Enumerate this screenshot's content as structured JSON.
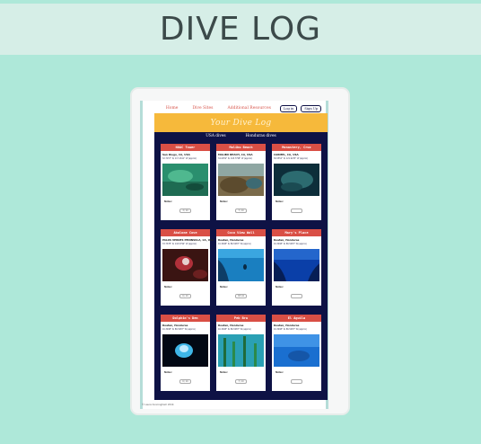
{
  "page": {
    "title": "DIVE LOG"
  },
  "nav": {
    "links": [
      "Home",
      "Dive Sites",
      "Additional Resources"
    ],
    "buttons": [
      "Log in",
      "Sign Up"
    ]
  },
  "banner": {
    "title": "Your Dive Log"
  },
  "subnav": {
    "tabs": [
      "USA dives",
      "Honduras dives"
    ]
  },
  "cards": [
    {
      "title": "NOAC Tower",
      "location": "San Diego, CA, USA",
      "coords": "32.7157° N, 117.1611° W (approx)",
      "notes": "Notes:",
      "rating": "3 / 10"
    },
    {
      "title": "Malibu Beach",
      "location": "MALIBU BEACH, CA, USA",
      "coords": "34.0259° N, 118.7798° W (approx)",
      "notes": "Notes:",
      "rating": "7 / 10"
    },
    {
      "title": "Monastery, Cruz",
      "location": "CARMEL, CA, USA",
      "coords": "36.5552° N, 121.9233° W (approx)",
      "notes": "Notes:",
      "rating": ""
    },
    {
      "title": "Abalone Cove",
      "location": "PALOS VERDES PENINSULA, CA, USA",
      "coords": "33.7378° N, 118.3794° W (approx)",
      "notes": "Notes:",
      "rating": "6 / 10"
    },
    {
      "title": "Coco View Wall",
      "location": "Roatan, Honduras",
      "coords": "16.3298° N, 86.5287° W (approx)",
      "notes": "Notes:",
      "rating": "3/5 10"
    },
    {
      "title": "Mary's Place",
      "location": "Roatan, Honduras",
      "coords": "16.3298° N, 86.5287° W (approx)",
      "notes": "Notes:",
      "rating": ""
    },
    {
      "title": "Dolphin's Den",
      "location": "Roatan, Honduras",
      "coords": "16.3298° N, 86.5287° W (approx)",
      "notes": "Notes:",
      "rating": "6 / 10"
    },
    {
      "title": "Peb Bra",
      "location": "Roatan, Honduras",
      "coords": "16.3298° N, 86.5287° W (approx)",
      "notes": "Notes:",
      "rating": "7 / 10"
    },
    {
      "title": "El Aguila",
      "location": "Roatan, Honduras",
      "coords": "16.3298° N, 86.5287° W (approx)",
      "notes": "Notes:",
      "rating": ""
    }
  ],
  "footer": {
    "text": "© Laura Cunningham 2014"
  },
  "colors": {
    "background": "#aee8d9",
    "banner": "#f6b93b",
    "card_header": "#d94f45",
    "main_panel": "#0e1245"
  }
}
